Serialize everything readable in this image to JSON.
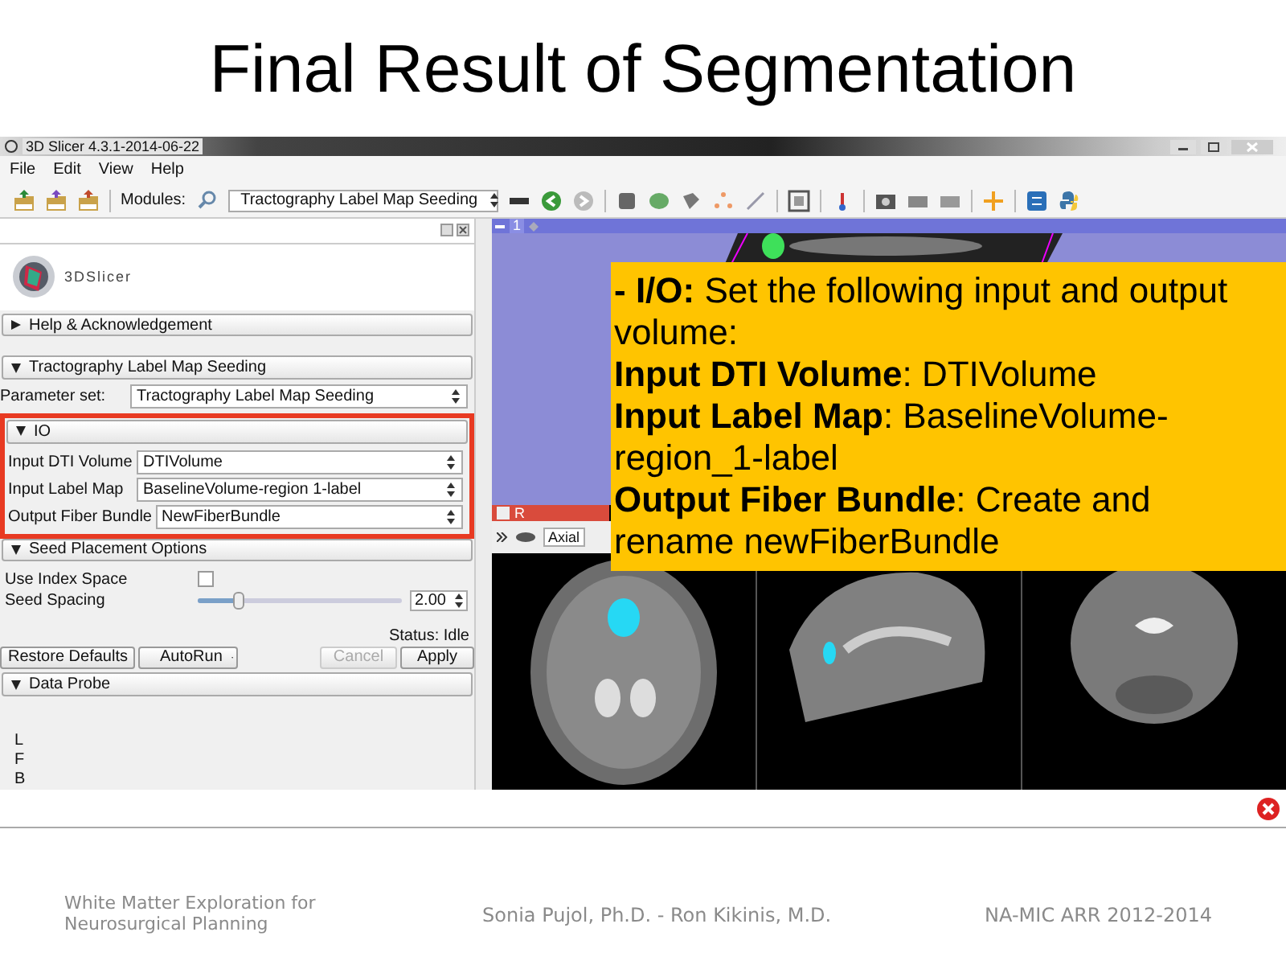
{
  "slide_title": "Final Result of Segmentation",
  "window": {
    "title": "3D Slicer 4.3.1-2014-06-22",
    "menu": [
      "File",
      "Edit",
      "View",
      "Help"
    ],
    "toolbar": {
      "modules_label": "Modules:",
      "module": "Tractography Label Map Seeding"
    }
  },
  "module_panel": {
    "logo": "3DSlicer",
    "help_section": {
      "label": "Help & Acknowledgement",
      "expanded": false
    },
    "module_section": {
      "label": "Tractography Label Map Seeding",
      "expanded": true
    },
    "parameter_set": {
      "label": "Parameter set:",
      "value": "Tractography Label Map Seeding"
    },
    "io_section": {
      "label": "IO",
      "expanded": true,
      "fields": [
        {
          "label": "Input DTI Volume",
          "value": "DTIVolume"
        },
        {
          "label": "Input Label Map",
          "value": "BaselineVolume-region 1-label"
        },
        {
          "label": "Output Fiber Bundle",
          "value": "NewFiberBundle"
        }
      ]
    },
    "seed_section": {
      "label": "Seed Placement Options",
      "expanded": true,
      "options": [
        {
          "kind": "checkbox",
          "label": "Use Index Space",
          "checked": false
        },
        {
          "kind": "slider",
          "label": "Seed Spacing",
          "level": 0.2,
          "value": "2.00"
        }
      ]
    },
    "status": "Status: Idle",
    "buttons": [
      {
        "kind": "button",
        "label": "Restore Defaults",
        "disabled": false
      },
      {
        "kind": "menu-button",
        "label": "AutoRun",
        "disabled": false
      },
      {
        "kind": "button",
        "label": "Cancel",
        "disabled": true
      },
      {
        "kind": "button",
        "label": "Apply",
        "disabled": false
      }
    ],
    "data_probe": {
      "label": "Data Probe",
      "expanded": true,
      "axes": [
        "L",
        "F",
        "B"
      ]
    }
  },
  "view": {
    "number": "1",
    "slice_label": "R",
    "orientation": "Axial"
  },
  "callout": [
    "**- I/O:** Set the following input and output volume:",
    "**Input DTI Volume**: DTIVolume",
    "**Input Label Map**: BaselineVolume-region_1-label",
    "**Output Fiber Bundle**: Create and rename newFiberBundle"
  ],
  "footer": {
    "left": [
      "White Matter Exploration for",
      "Neurosurgical Planning"
    ],
    "center": "Sonia Pujol, Ph.D. - Ron Kikinis, M.D.",
    "right": "NA-MIC ARR 2012-2014"
  }
}
